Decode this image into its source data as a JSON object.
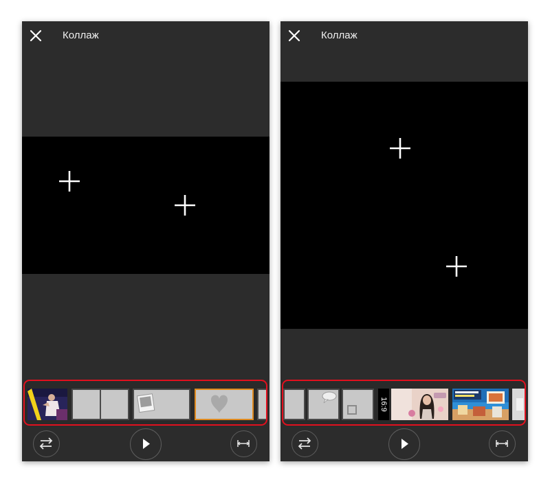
{
  "screens": [
    {
      "title": "Коллаж"
    },
    {
      "title": "Коллаж",
      "aspect_ratio_label": "16:9"
    }
  ],
  "icons": {
    "close": "close-icon",
    "add_photo": "plus-icon",
    "swap": "swap-arrows-icon",
    "play": "play-icon",
    "spacing": "spacing-icon"
  },
  "colors": {
    "screen_bg": "#2c2c2c",
    "canvas_bg": "#000000",
    "highlight_border": "#e3101e",
    "selected_thumb_border": "#e08a1e"
  }
}
